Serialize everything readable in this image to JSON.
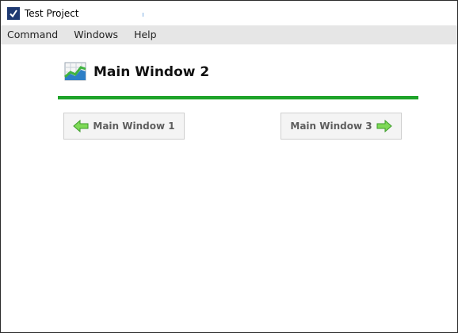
{
  "window": {
    "title": "Test Project",
    "app_icon": "checkmark-icon"
  },
  "menubar": {
    "items": [
      {
        "label": "Command"
      },
      {
        "label": "Windows"
      },
      {
        "label": "Help"
      }
    ]
  },
  "main": {
    "title": "Main Window 2",
    "title_icon": "chart-icon",
    "accent_color": "#1fa32a",
    "prev_button": {
      "label": "Main Window 1",
      "icon": "arrow-left-icon"
    },
    "next_button": {
      "label": "Main Window 3",
      "icon": "arrow-right-icon"
    }
  }
}
